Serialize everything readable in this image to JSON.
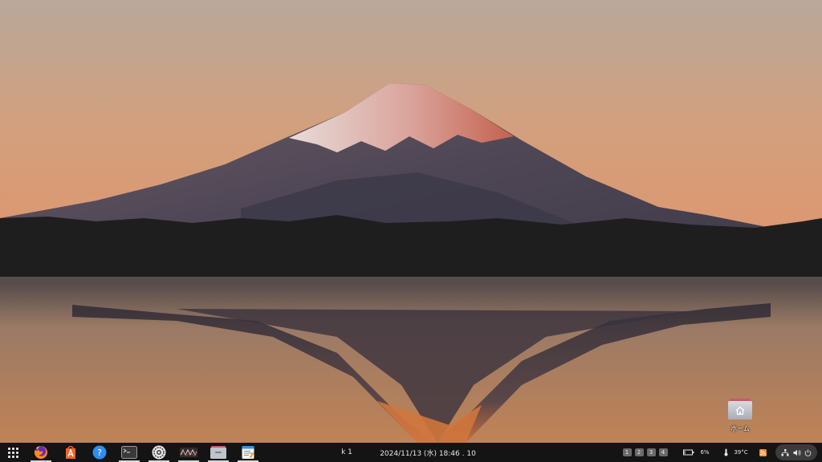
{
  "desktop": {
    "icons": [
      {
        "label": "ホーム",
        "icon": "home-folder-icon"
      }
    ]
  },
  "taskbar": {
    "launcher_icon": "app-grid-icon",
    "apps": [
      {
        "name": "firefox",
        "icon": "firefox-icon",
        "running": true
      },
      {
        "name": "software",
        "icon": "app-store-icon",
        "running": false
      },
      {
        "name": "help",
        "icon": "help-icon",
        "running": false
      },
      {
        "name": "terminal",
        "icon": "terminal-icon",
        "running": true
      },
      {
        "name": "settings",
        "icon": "gear-icon",
        "running": true
      },
      {
        "name": "system-monitor",
        "icon": "monitor-icon",
        "running": true
      },
      {
        "name": "files",
        "icon": "file-manager-icon",
        "running": true
      },
      {
        "name": "text-editor",
        "icon": "text-editor-icon",
        "running": true
      }
    ],
    "keyboard_indicator": "k 1",
    "datetime": "2024/11/13 (水) 18:46 . 10",
    "workspaces": [
      "1",
      "2",
      "3",
      "4"
    ],
    "battery_percent": "6%",
    "temperature": "39°C",
    "colors": {
      "bar": "#141414",
      "tray": "#3b3b3b",
      "feed_orange": "#f08a24"
    }
  }
}
